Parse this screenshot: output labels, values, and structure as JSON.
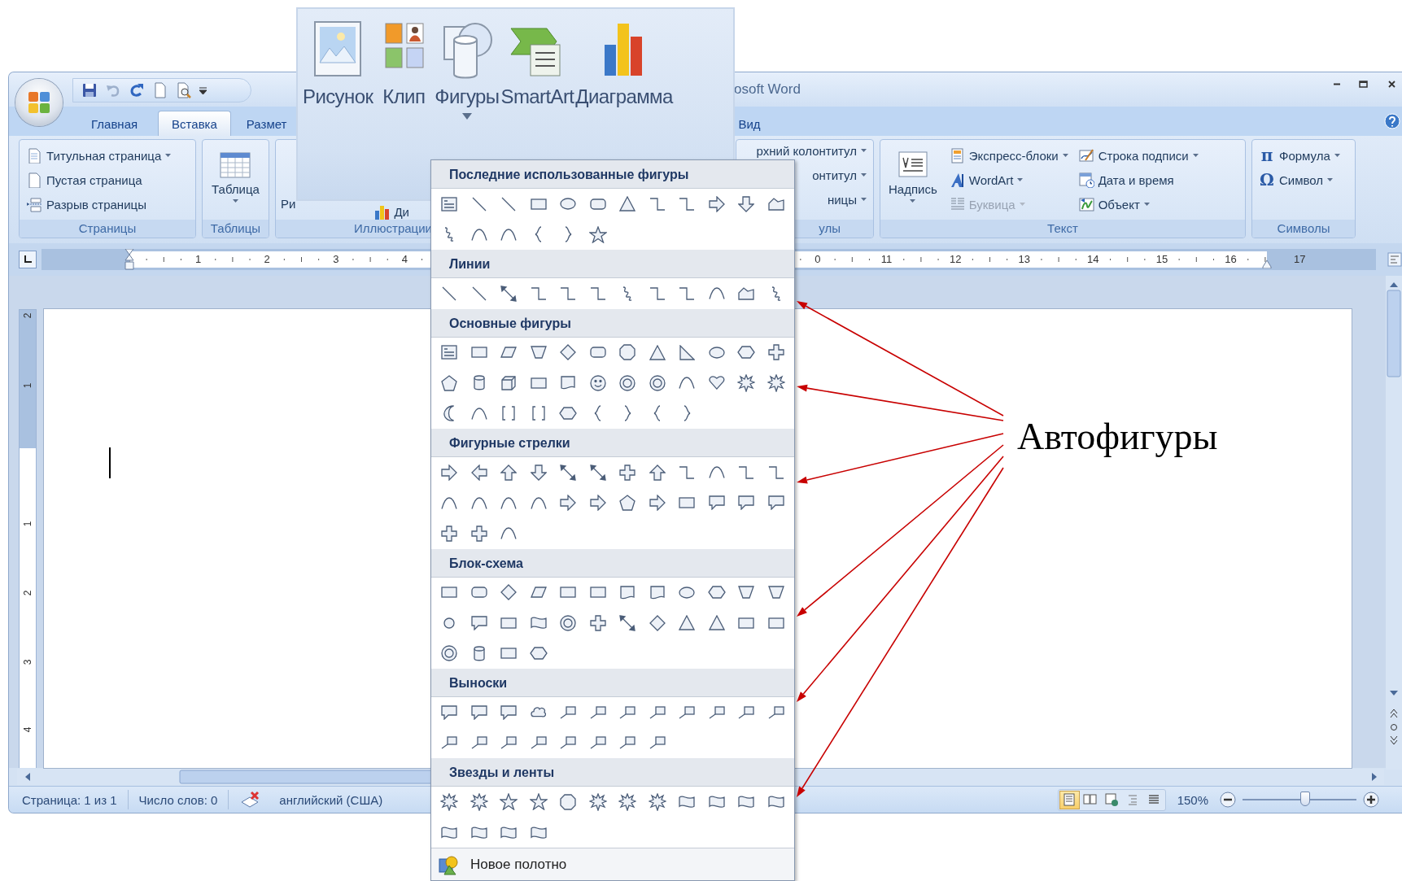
{
  "word_window": {
    "title": "osoft Word",
    "tabs": [
      {
        "label": "Главная",
        "selected": false
      },
      {
        "label": "Вставка",
        "selected": true
      },
      {
        "label": "Размет",
        "selected": false
      },
      {
        "label": "Вид",
        "selected": false
      }
    ],
    "ribbon_groups": [
      {
        "kind": "list",
        "label": "Страницы",
        "items": [
          {
            "label": "Титульная страница",
            "dropdown": true,
            "disabled": false
          },
          {
            "label": "Пустая страница",
            "dropdown": false,
            "disabled": false
          },
          {
            "label": "Разрыв страницы",
            "dropdown": false,
            "disabled": false
          }
        ]
      },
      {
        "kind": "large",
        "label": "Таблицы",
        "items": [
          {
            "label": "Таблица",
            "dropdown": true,
            "disabled": false
          }
        ]
      },
      {
        "kind": "partial",
        "label": "Иллюстрации",
        "items": [
          {
            "label": "Ри",
            "dropdown": false,
            "disabled": false
          },
          {
            "label": "Ди",
            "dropdown": false,
            "disabled": false
          }
        ]
      },
      {
        "kind": "list",
        "label": "улы",
        "items": [
          {
            "label": "рхний колонтитул",
            "dropdown": true,
            "disabled": false
          },
          {
            "label": "онтитул",
            "dropdown": true,
            "disabled": false
          },
          {
            "label": "ницы",
            "dropdown": true,
            "disabled": false
          }
        ]
      },
      {
        "kind": "text",
        "label": "Текст",
        "items": [
          {
            "label": "Надпись",
            "dropdown": true,
            "disabled": false
          },
          {
            "label": "Экспресс-блоки",
            "dropdown": true,
            "disabled": false
          },
          {
            "label": "WordArt",
            "dropdown": true,
            "disabled": false
          },
          {
            "label": "Буквица",
            "dropdown": true,
            "disabled": true
          },
          {
            "label": "Строка подписи",
            "dropdown": true,
            "disabled": false
          },
          {
            "label": "Дата и время",
            "dropdown": false,
            "disabled": false
          },
          {
            "label": "Объект",
            "dropdown": true,
            "disabled": false
          }
        ]
      },
      {
        "kind": "list",
        "label": "Символы",
        "items": [
          {
            "label": "Формула",
            "icon": "π",
            "dropdown": true,
            "disabled": false
          },
          {
            "label": "Символ",
            "icon": "Ω",
            "dropdown": true,
            "disabled": false
          }
        ]
      }
    ],
    "ruler_numbers": [
      "1",
      "2",
      "3",
      "4",
      "0",
      "11",
      "12",
      "13",
      "14",
      "15",
      "16",
      "17"
    ],
    "vertical_ruler_numbers": [
      "2",
      "1",
      "1",
      "2",
      "3",
      "4"
    ],
    "status_bar": {
      "items": [
        "Страница: 1 из 1",
        "Число слов: 0",
        "английский (США)"
      ],
      "views": [
        {
          "selected": true
        },
        {
          "selected": false
        },
        {
          "selected": false
        },
        {
          "selected": false
        },
        {
          "selected": false
        }
      ],
      "zoom": "150%",
      "zoom_slider": {
        "level": 0.55
      }
    }
  },
  "ribbon_zoom": {
    "buttons": [
      {
        "label": "Рисунок",
        "dropdown": false
      },
      {
        "label": "Клип",
        "dropdown": false
      },
      {
        "label": "Фигуры",
        "dropdown": true
      },
      {
        "label": "SmartArt",
        "dropdown": false
      },
      {
        "label": "Диаграмма",
        "dropdown": false
      }
    ]
  },
  "shapes_gallery": {
    "sections": [
      {
        "title": "Последние использованные фигуры"
      },
      {
        "title": "Линии"
      },
      {
        "title": "Основные фигуры"
      },
      {
        "title": "Фигурные стрелки"
      },
      {
        "title": "Блок-схема"
      },
      {
        "title": "Выноски"
      },
      {
        "title": "Звезды и ленты"
      }
    ],
    "footer": "Новое полотно"
  },
  "annotation": "Автофигуры"
}
